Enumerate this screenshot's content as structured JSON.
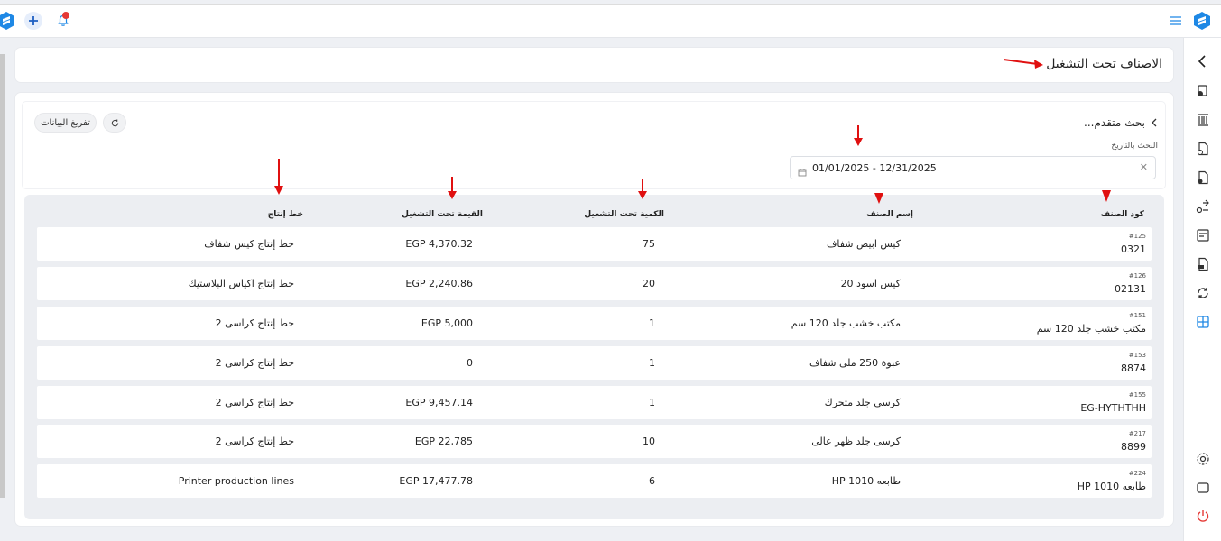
{
  "page_title": "الاصناف تحت التشغيل",
  "toolbar": {
    "notification_count": ""
  },
  "filters": {
    "advanced_search": "بحث متقدم...",
    "date_label": "البحث بالتاريخ",
    "date_range": "01/01/2025 - 12/31/2025",
    "clear_label": "تفريغ البيانات"
  },
  "table": {
    "headers": {
      "code": "كود الصنف",
      "name": "إسم الصنف",
      "qty": "الكمية تحت التشغيل",
      "value": "القيمة تحت التشغيل",
      "line": "خط إنتاج"
    },
    "rows": [
      {
        "id": "#125",
        "code": "0321",
        "name": "كيس ابيض شفاف",
        "qty": "75",
        "value": "EGP 4,370.32",
        "line": "خط إنتاج كيس شفاف"
      },
      {
        "id": "#126",
        "code": "02131",
        "name": "كيس اسود 20",
        "qty": "20",
        "value": "EGP 2,240.86",
        "line": "خط إنتاج اكياس البلاستيك"
      },
      {
        "id": "#151",
        "code": "مكتب خشب جلد 120 سم",
        "name": "مكتب خشب جلد 120 سم",
        "qty": "1",
        "value": "EGP 5,000",
        "line": "خط إنتاج كراسى 2"
      },
      {
        "id": "#153",
        "code": "8874",
        "name": "عبوة  250 ملى شفاف",
        "qty": "1",
        "value": "0",
        "line": "خط إنتاج كراسى 2"
      },
      {
        "id": "#155",
        "code": "EG-HYTHTHH",
        "name": "كرسى جلد متحرك",
        "qty": "1",
        "value": "EGP 9,457.14",
        "line": "خط إنتاج كراسى 2"
      },
      {
        "id": "#217",
        "code": "8899",
        "name": "كرسى جلد ظهر عالى",
        "qty": "10",
        "value": "EGP 22,785",
        "line": "خط إنتاج كراسى 2"
      },
      {
        "id": "#224",
        "code": "طابعه HP 1010",
        "name": "طابعه HP 1010",
        "qty": "6",
        "value": "EGP 17,477.78",
        "line": "Printer production lines"
      }
    ]
  },
  "colors": {
    "accent": "#1e88e5",
    "annotation_arrow": "#e01010",
    "danger": "#e53935"
  },
  "icons": [
    "logo-icon",
    "plus-icon",
    "bell-icon",
    "menu-icon",
    "chevron-left-icon",
    "refresh-icon",
    "calendar-icon",
    "gear-icon",
    "window-icon",
    "power-icon"
  ]
}
